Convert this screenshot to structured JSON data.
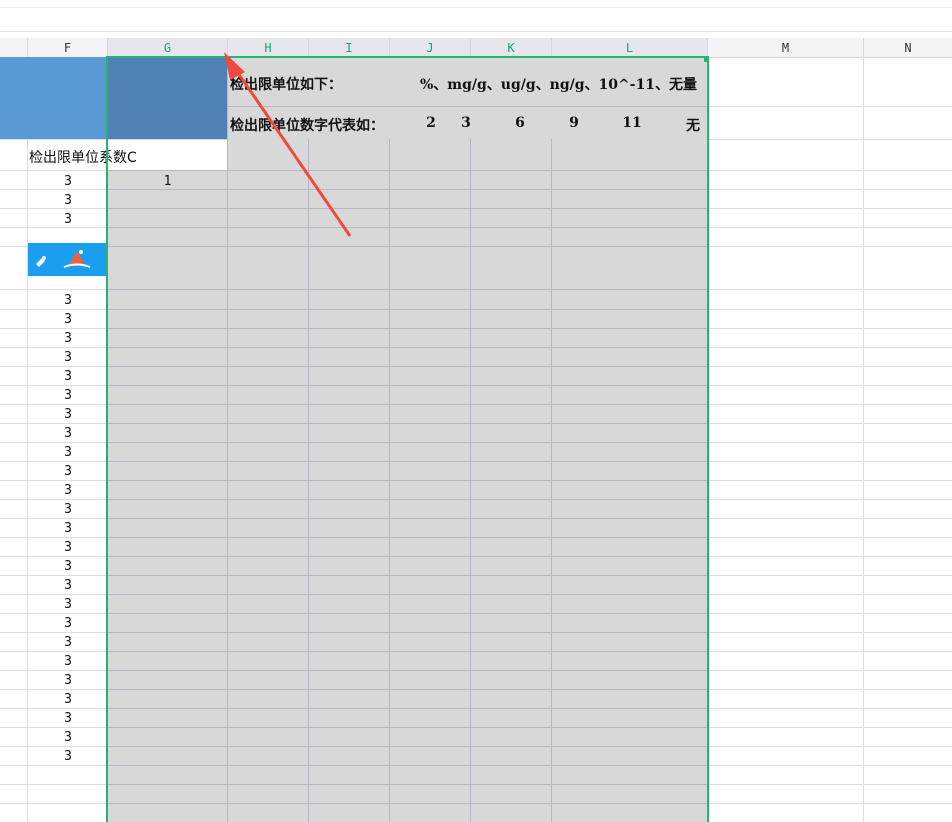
{
  "columns": [
    "F",
    "G",
    "H",
    "I",
    "J",
    "K",
    "L",
    "M",
    "N"
  ],
  "selected_columns": [
    "G",
    "H",
    "I",
    "J",
    "K",
    "L"
  ],
  "cells": {
    "row1_label": "检出限单位如下：",
    "row1_units": "%、mg/g、ug/g、ng/g、10^-11、无量",
    "row2_label": "检出限单位数字代表如：",
    "row2_codes": [
      "2",
      "3",
      "6",
      "9",
      "11",
      "无"
    ],
    "f3_label": "检出限单位系数C",
    "g4_value": "1"
  },
  "column_f_values": [
    "3",
    "3",
    "3",
    "3",
    "3",
    "3",
    "3",
    "3",
    "3",
    "3",
    "3",
    "3",
    "3",
    "3",
    "3",
    "3",
    "3",
    "3",
    "3",
    "3",
    "3",
    "3",
    "3",
    "3",
    "3",
    "3",
    "3",
    "3",
    "3",
    "3"
  ],
  "colors": {
    "selection_outline": "#22b573",
    "header_blue": "#5b9bd5",
    "selected_blue": "#4f81b4",
    "selection_fill": "#d8d8d8",
    "annotation_arrow": "#f04a3e"
  },
  "icons": [
    "embedded-image-icon"
  ]
}
